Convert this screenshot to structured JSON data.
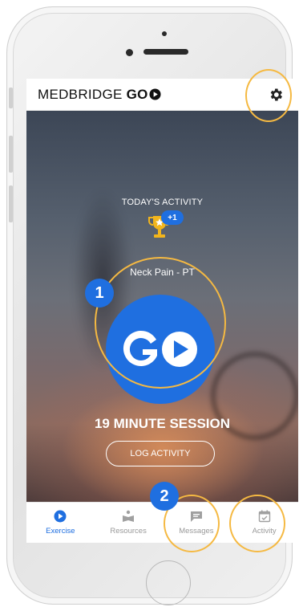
{
  "app": {
    "brand_text": "MEDBRIDGE",
    "brand_go": "GO"
  },
  "icons": {
    "settings": "gear-icon",
    "trophy": "trophy-icon",
    "go": "go-play-icon"
  },
  "hero": {
    "today_label": "TODAY'S ACTIVITY",
    "streak_badge": "+1",
    "plan_name": "Neck Pain - PT",
    "go_button_label": "GO",
    "session_label": "19 MINUTE SESSION",
    "log_button_label": "LOG ACTIVITY"
  },
  "tabs": [
    {
      "label": "Exercise",
      "icon": "play-circle-icon",
      "active": true
    },
    {
      "label": "Resources",
      "icon": "reader-icon",
      "active": false
    },
    {
      "label": "Messages",
      "icon": "chat-icon",
      "active": false
    },
    {
      "label": "Activity",
      "icon": "calendar-check-icon",
      "active": false
    }
  ],
  "callouts": {
    "step1": "1",
    "step2": "2"
  },
  "colors": {
    "accent": "#1f6fe0",
    "highlight_ring": "#f5b942",
    "trophy": "#f2b51c"
  }
}
